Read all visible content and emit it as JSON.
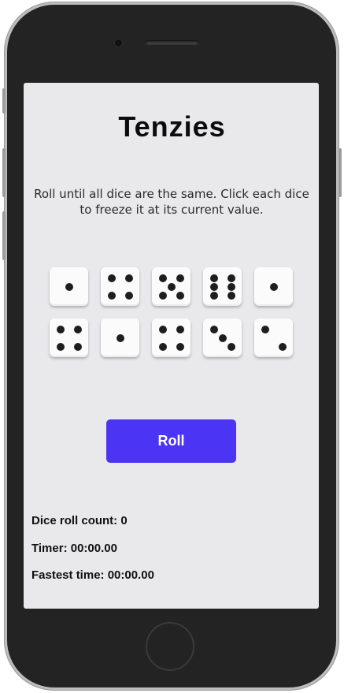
{
  "app": {
    "title": "Tenzies",
    "instructions": "Roll until all dice are the same. Click each dice to freeze it at its current value."
  },
  "dice": [
    {
      "value": 1,
      "held": false
    },
    {
      "value": 4,
      "held": false
    },
    {
      "value": 5,
      "held": false
    },
    {
      "value": 6,
      "held": false
    },
    {
      "value": 1,
      "held": false
    },
    {
      "value": 4,
      "held": false
    },
    {
      "value": 1,
      "held": false
    },
    {
      "value": 4,
      "held": false
    },
    {
      "value": 3,
      "held": false
    },
    {
      "value": 2,
      "held": false
    }
  ],
  "roll_button": {
    "label": "Roll"
  },
  "stats": {
    "roll_count": "Dice roll count: 0",
    "timer": "Timer: 00:00.00",
    "fastest_time": "Fastest time: 00:00.00"
  },
  "colors": {
    "accent": "#4b34f4",
    "screen_bg": "#e9e9ec",
    "phone_body": "#232323"
  }
}
